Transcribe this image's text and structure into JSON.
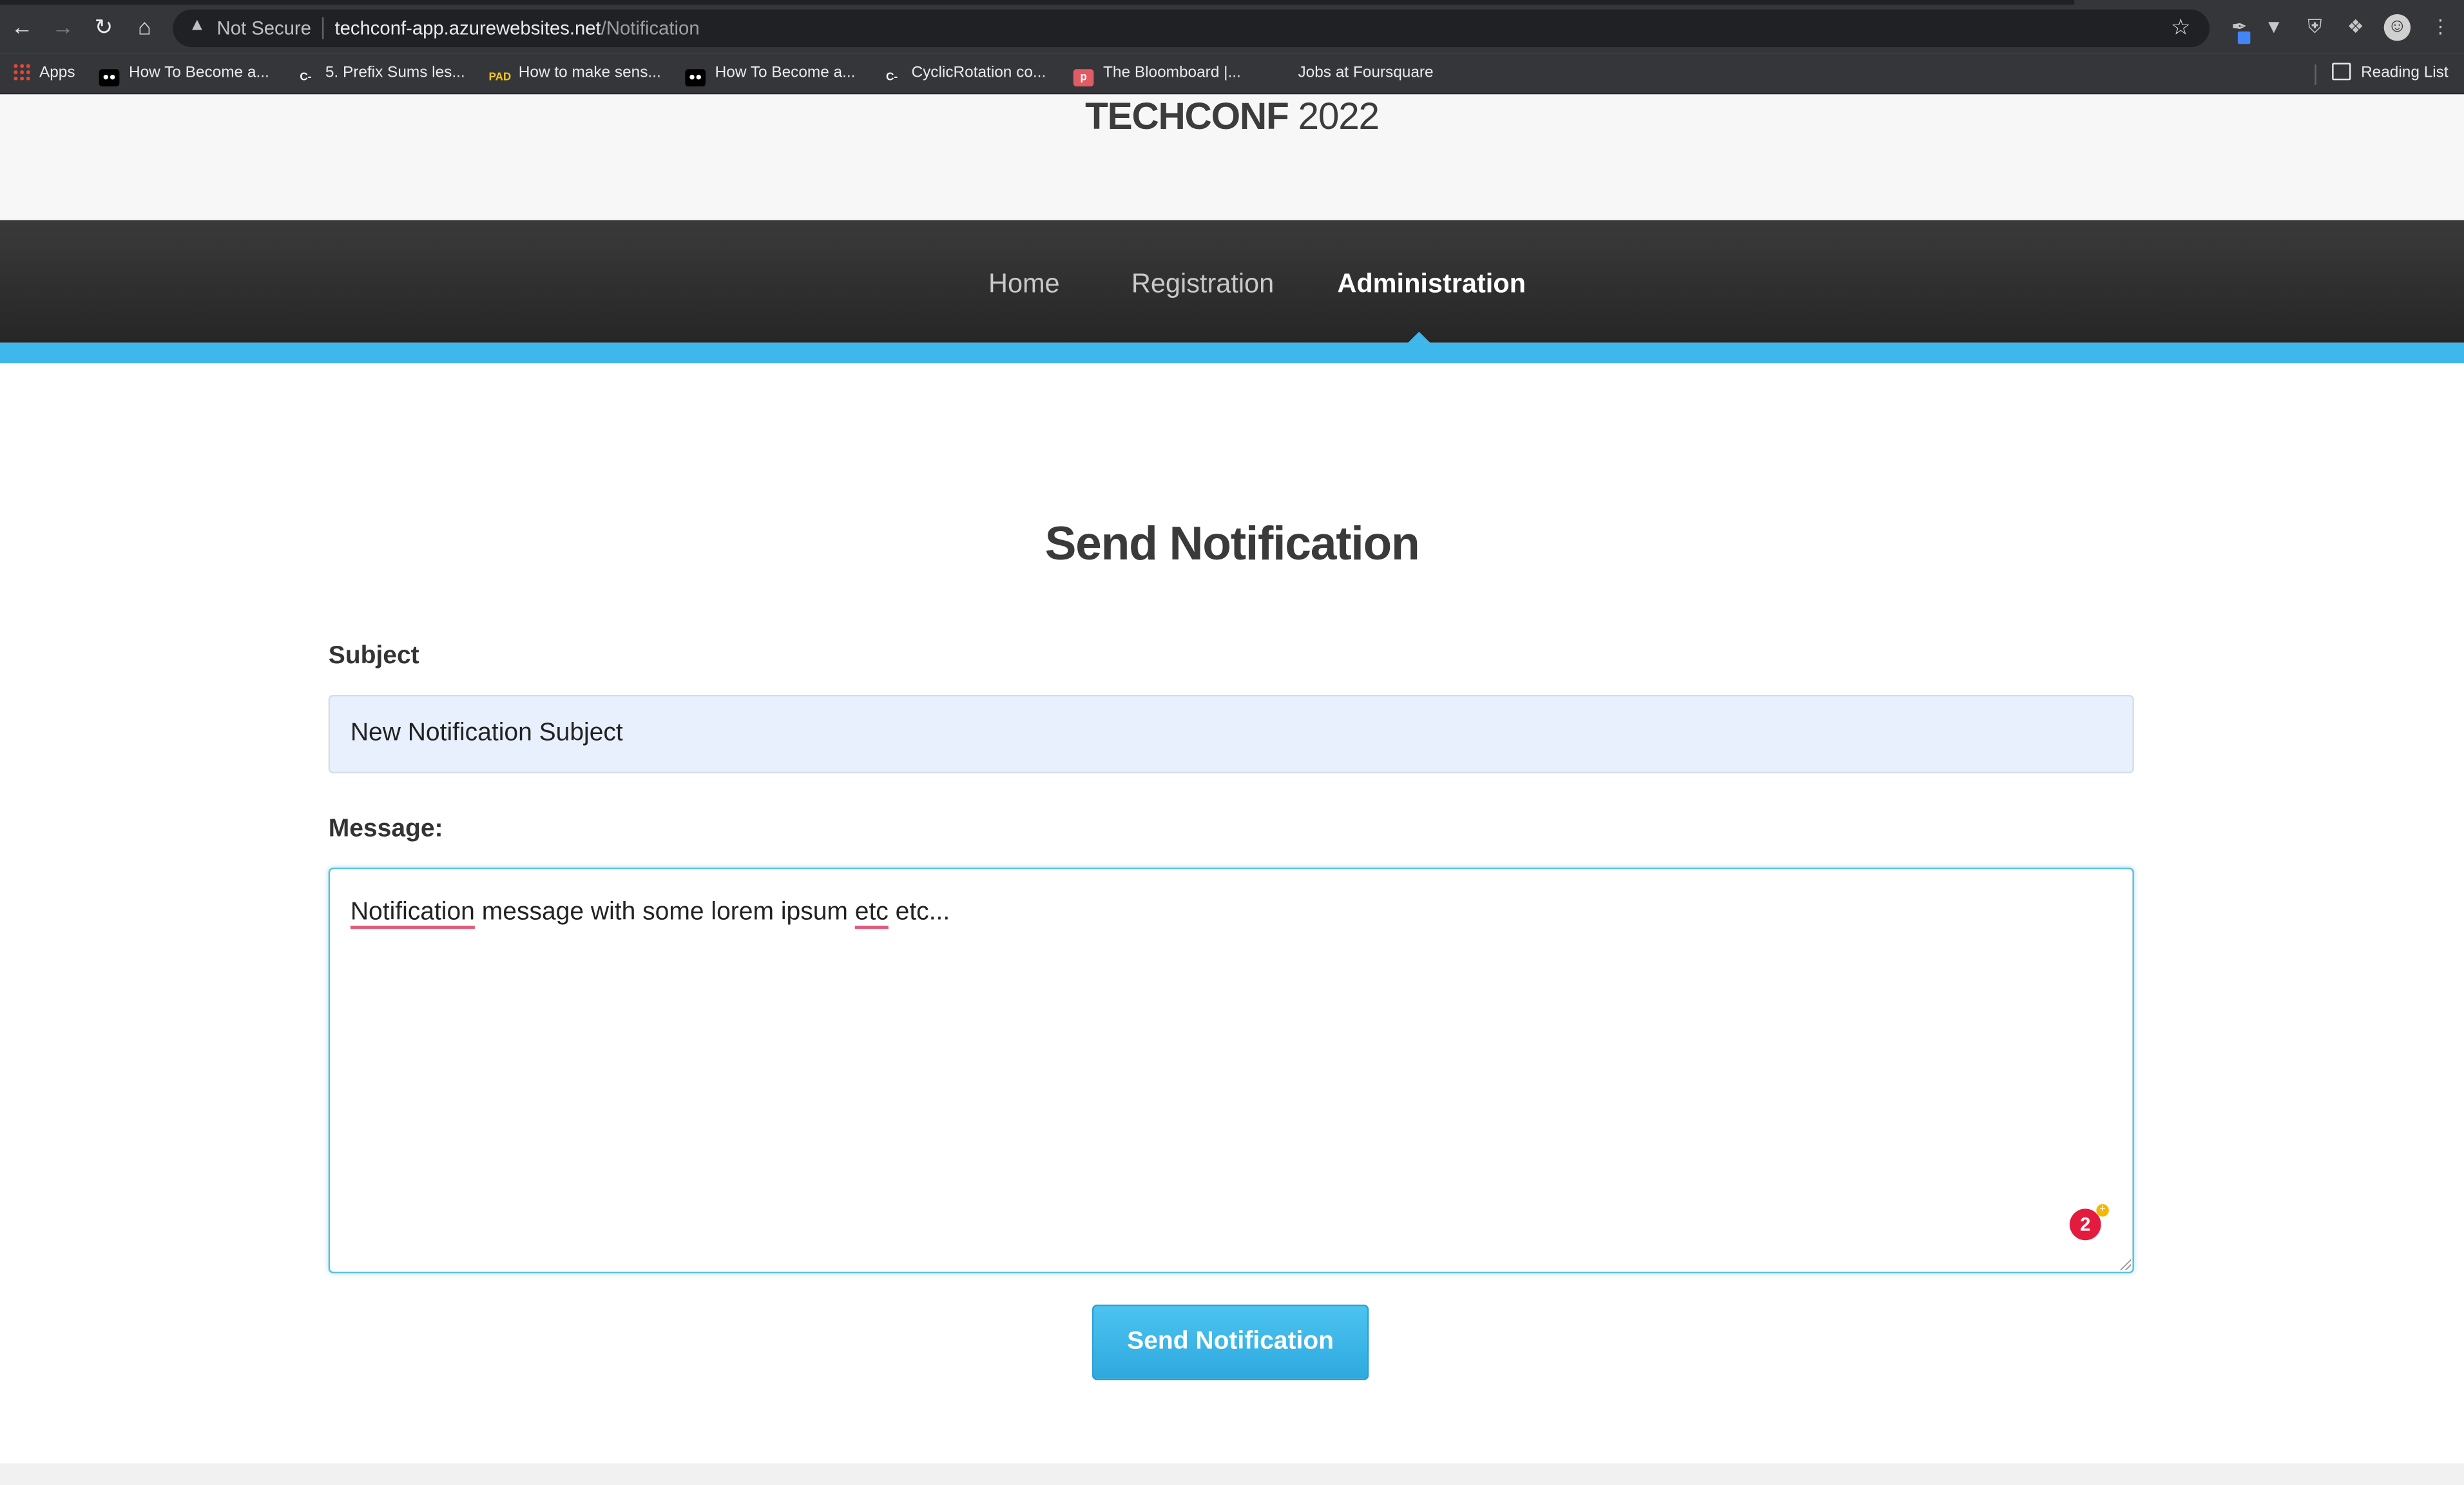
{
  "browser": {
    "not_secure_label": "Not Secure",
    "url_host": "techconf-app.azurewebsites.net",
    "url_path": "/Notification",
    "bookmarks": [
      "Apps",
      "How To Become a...",
      "5. Prefix Sums les...",
      "How to make sens...",
      "How To Become a...",
      "CyclicRotation co...",
      "The Bloomboard |...",
      "Jobs at Foursquare"
    ],
    "reading_list": "Reading List"
  },
  "site": {
    "brand_bold": "TECHCONF",
    "brand_year": " 2022",
    "nav": [
      "Home",
      "Registration",
      "Administration"
    ],
    "active_nav": "Administration"
  },
  "form": {
    "title": "Send Notification",
    "subject_label": "Subject",
    "subject_value": "New Notification Subject",
    "message_label": "Message:",
    "message_word1": "Notification",
    "message_middle": " message with some lorem ipsum ",
    "message_word2": "etc",
    "message_end": " etc...",
    "grammarly_count": "2",
    "submit_label": "Send Notification"
  },
  "colors": {
    "accent": "#3db7ec",
    "navbar": "#2d2d2d",
    "input_autofill": "#e8f0fe",
    "grammarly": "#e31b3f"
  }
}
